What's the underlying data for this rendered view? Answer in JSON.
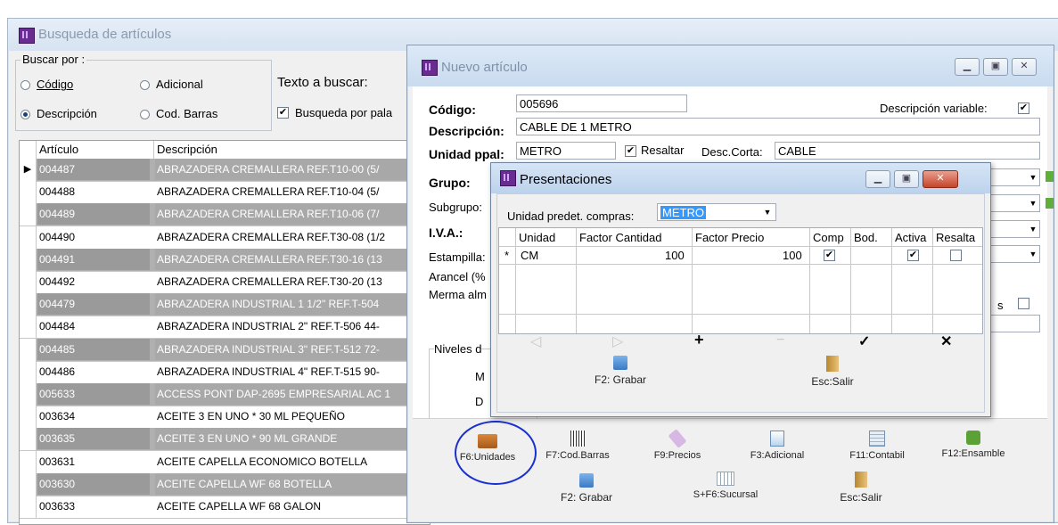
{
  "busqueda": {
    "title": "Busqueda de artículos",
    "buscar_por": "Buscar por :",
    "radio_codigo": "Código",
    "radio_adicional": "Adicional",
    "radio_descripcion": "Descripción",
    "radio_cod_barras": "Cod. Barras",
    "texto_buscar": "Texto a buscar:",
    "busqueda_palabra": "Busqueda por pala",
    "col_articulo": "Artículo",
    "col_descripcion": "Descripción",
    "rows": [
      {
        "code": "004487",
        "desc": "ABRAZADERA CREMALLERA REF.T10-00  (5/"
      },
      {
        "code": "004488",
        "desc": "ABRAZADERA CREMALLERA REF.T10-04  (5/"
      },
      {
        "code": "004489",
        "desc": "ABRAZADERA CREMALLERA REF.T10-06  (7/"
      },
      {
        "code": "004490",
        "desc": "ABRAZADERA CREMALLERA REF.T30-08  (1/2"
      },
      {
        "code": "004491",
        "desc": "ABRAZADERA CREMALLERA REF.T30-16  (13"
      },
      {
        "code": "004492",
        "desc": "ABRAZADERA CREMALLERA REF.T30-20  (13"
      },
      {
        "code": "004479",
        "desc": "ABRAZADERA INDUSTRIAL 1 1/2\" REF.T-504"
      },
      {
        "code": "004484",
        "desc": "ABRAZADERA INDUSTRIAL 2\" REF.T-506  44-"
      },
      {
        "code": "004485",
        "desc": "ABRAZADERA INDUSTRIAL 3\" REF.T-512  72-"
      },
      {
        "code": "004486",
        "desc": "ABRAZADERA INDUSTRIAL 4\" REF.T-515  90-"
      },
      {
        "code": "005633",
        "desc": "ACCESS PONT DAP-2695 EMPRESARIAL AC 1"
      },
      {
        "code": "003634",
        "desc": "ACEITE 3 EN UNO * 30 ML PEQUEÑO"
      },
      {
        "code": "003635",
        "desc": "ACEITE 3 EN UNO * 90 ML GRANDE"
      },
      {
        "code": "003631",
        "desc": "ACEITE CAPELLA ECONOMICO BOTELLA"
      },
      {
        "code": "003630",
        "desc": "ACEITE CAPELLA WF 68 BOTELLA"
      },
      {
        "code": "003633",
        "desc": "ACEITE CAPELLA WF 68 GALON"
      }
    ]
  },
  "nuevo": {
    "title": "Nuevo artículo",
    "codigo_label": "Código:",
    "codigo_value": "005696",
    "desc_variable": "Descripción variable:",
    "descripcion_label": "Descripción:",
    "descripcion_value": "CABLE DE 1 METRO",
    "unidad_label": "Unidad ppal:",
    "unidad_value": "METRO",
    "resaltar": "Resaltar",
    "desc_corta_label": "Desc.Corta:",
    "desc_corta_value": "CABLE",
    "grupo": "Grupo:",
    "subgrupo": "Subgrupo:",
    "iva": "I.V.A.:",
    "estampilla": "Estampilla:",
    "arancel": "Arancel (%",
    "merma": "Merma alm",
    "niveles": "Niveles d",
    "ma": "M",
    "di": "D",
    "extra_s": "s",
    "toolbar": [
      {
        "label": "F6:Unidades",
        "icon": "box-icon"
      },
      {
        "label": "F7:Cod.Barras",
        "icon": "barcode-icon"
      },
      {
        "label": "F9:Precios",
        "icon": "price-tag-icon"
      },
      {
        "label": "F3:Adicional",
        "icon": "card-icon"
      },
      {
        "label": "F11:Contabil",
        "icon": "ledger-icon"
      },
      {
        "label": "F12:Ensamble",
        "icon": "puzzle-icon"
      }
    ],
    "grabar": "F2: Grabar",
    "sucursal": "S+F6:Sucursal",
    "salir": "Esc:Salir"
  },
  "presentaciones": {
    "title": "Presentaciones",
    "unidad_compras_label": "Unidad predet. compras:",
    "unidad_compras_value": "METRO",
    "cols": [
      "Unidad",
      "Factor Cantidad",
      "Factor Precio",
      "Comp",
      "Bod.",
      "Activa",
      "Resalta"
    ],
    "row": {
      "marker": "*",
      "unidad": "CM",
      "factor_cantidad": "100",
      "factor_precio": "100"
    },
    "nav": [
      "◁",
      "▷",
      "+",
      "−",
      "✓",
      "✕"
    ],
    "grabar": "F2: Grabar",
    "salir": "Esc:Salir"
  },
  "colors": {
    "highlight_circle": "#1a2fd0",
    "accent": "#6a2c91"
  }
}
